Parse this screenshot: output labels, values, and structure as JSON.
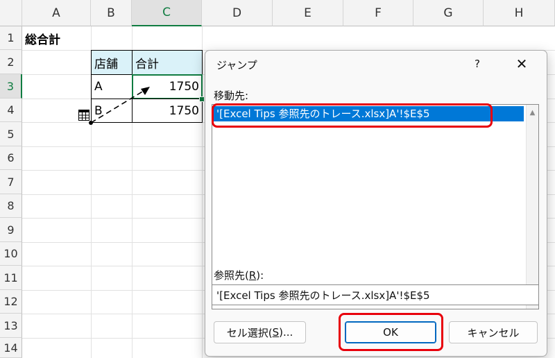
{
  "sheet": {
    "columns": [
      "A",
      "B",
      "C",
      "D",
      "E",
      "F",
      "G",
      "H"
    ],
    "rows": [
      "1",
      "2",
      "3",
      "4",
      "5",
      "6",
      "7",
      "8",
      "9",
      "10",
      "11",
      "12",
      "13",
      "14"
    ],
    "cells": {
      "a1": "総合計",
      "b2": "店舗",
      "c2": "合計",
      "b3": "A",
      "c3": "1750",
      "b4": "B",
      "c4": "1750"
    }
  },
  "dialog": {
    "title": "ジャンプ",
    "help": "?",
    "close": "✕",
    "goto_label": "移動先:",
    "list_items": [
      "'[Excel Tips 参照先のトレース.xlsx]A'!$E$5"
    ],
    "reference_label_prefix": "参照先(",
    "reference_label_key": "R",
    "reference_label_suffix": "):",
    "reference_value": "'[Excel Tips 参照先のトレース.xlsx]A'!$E$5",
    "special_button_prefix": "セル選択(",
    "special_button_key": "S",
    "special_button_suffix": ")...",
    "ok_label": "OK",
    "cancel_label": "キャンセル"
  },
  "colors": {
    "accent_green": "#107c41",
    "selection_blue": "#0078d7",
    "highlight_red": "#e8000b"
  }
}
